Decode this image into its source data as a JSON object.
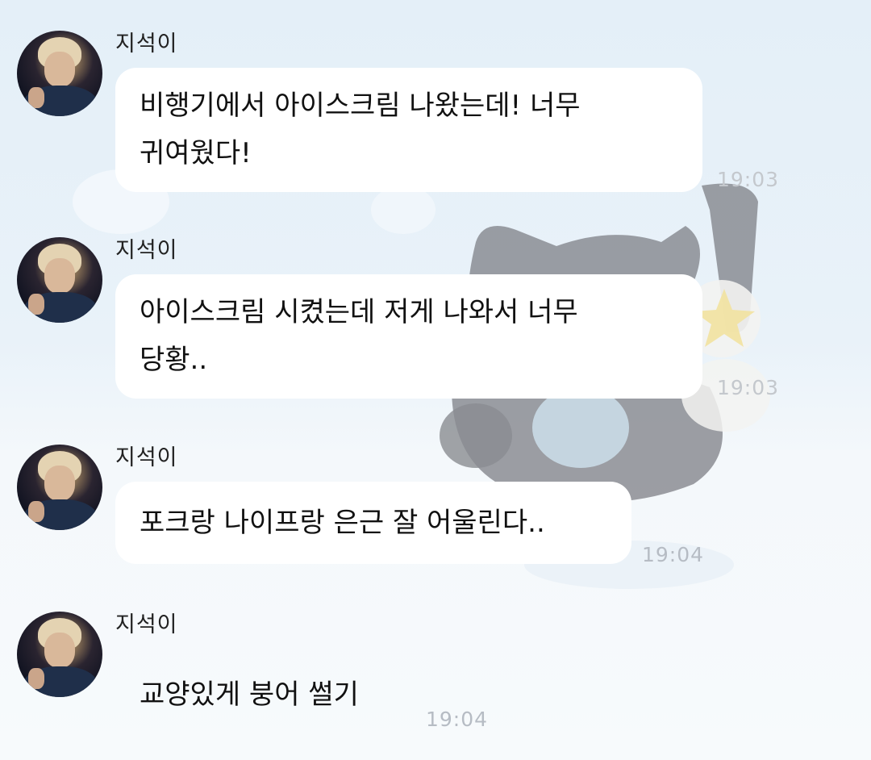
{
  "chat": {
    "messages": [
      {
        "sender": "지석이",
        "text": "비행기에서 아이스크림 나왔는데! 너무\n귀여웠다!",
        "time": "19:03"
      },
      {
        "sender": "지석이",
        "text": "아이스크림 시켰는데 저게 나와서 너무\n당황..",
        "time": "19:03"
      },
      {
        "sender": "지석이",
        "text": "포크랑 나이프랑 은근 잘 어울린다..",
        "time": "19:04"
      },
      {
        "sender": "지석이",
        "text": "교양있게 붕어 썰기",
        "time": "19:04"
      }
    ]
  },
  "colors": {
    "bubble": "#ffffff",
    "timestamp": "#b6bcc4",
    "background": "#e4eff8"
  },
  "icons": {
    "background_art": "cat-character-holding-fork-and-knife"
  }
}
